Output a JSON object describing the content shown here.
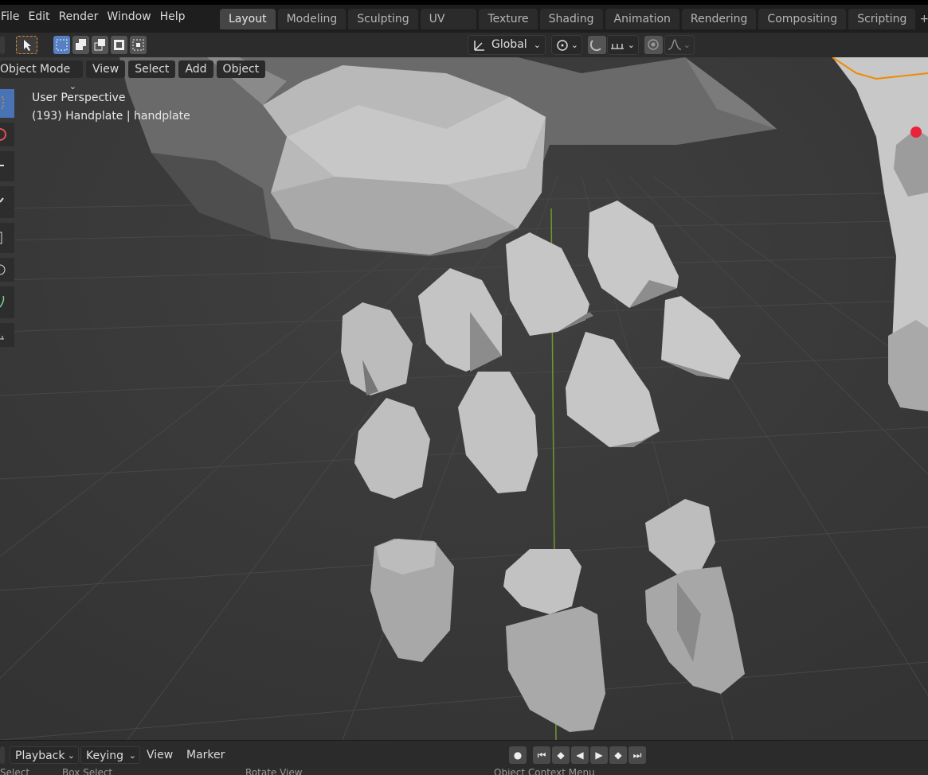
{
  "menu": [
    "File",
    "Edit",
    "Render",
    "Window",
    "Help"
  ],
  "workspaces": [
    "Layout",
    "Modeling",
    "Sculpting",
    "UV Editing",
    "Texture Paint",
    "Shading",
    "Animation",
    "Rendering",
    "Compositing",
    "Scripting"
  ],
  "active_workspace": "Layout",
  "tool_header": {
    "transform_orientation": "Global"
  },
  "viewport_header": {
    "mode": "Object Mode",
    "items": [
      "View",
      "Select",
      "Add",
      "Object"
    ]
  },
  "overlay": {
    "view_name": "User Perspective",
    "object_info": "(193) Handplate | handplate"
  },
  "timeline": {
    "playback": "Playback",
    "keying": "Keying",
    "view": "View",
    "marker": "Marker"
  },
  "statusbar": {
    "select": "Select",
    "box_select": "Box Select",
    "rotate_view": "Rotate View",
    "context_menu": "Object Context Menu"
  },
  "colors": {
    "accent_blue": "#5680c2",
    "selection_orange": "#f08a00",
    "axis_green": "#7fa23a",
    "bone_red": "#e8233a"
  }
}
